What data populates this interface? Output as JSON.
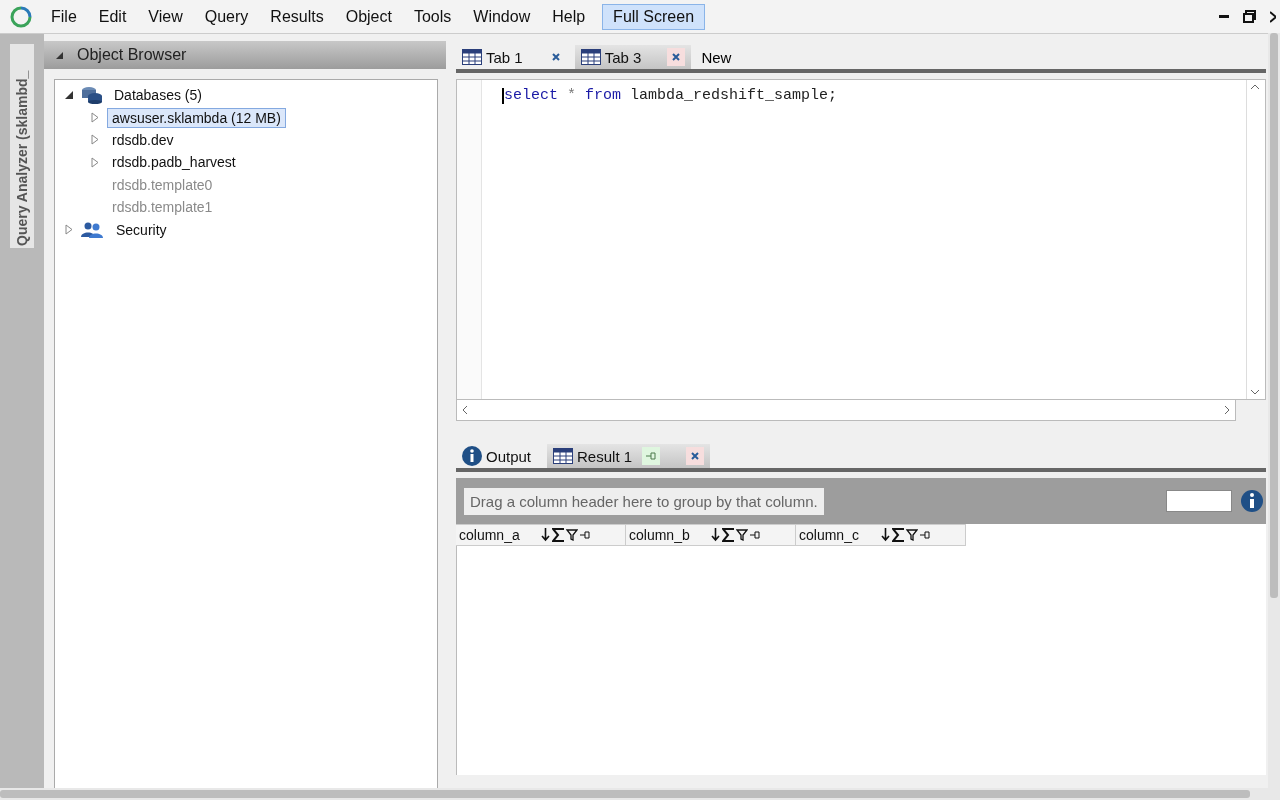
{
  "menu": [
    "File",
    "Edit",
    "View",
    "Query",
    "Results",
    "Object",
    "Tools",
    "Window",
    "Help"
  ],
  "full_screen_button": {
    "label": "Full Screen",
    "on": true
  },
  "side_strip": {
    "title": "Query Analyzer (sklambd_"
  },
  "object_browser": {
    "title": "Object Browser",
    "tree": [
      {
        "label": "Databases (5)",
        "kind": "database",
        "expanded": true,
        "selected": false,
        "disabled": false,
        "children": [
          {
            "label": "awsuser.sklambda (12 MB)",
            "expanded": false,
            "selected": true,
            "disabled": false
          },
          {
            "label": "rdsdb.dev",
            "expanded": false,
            "selected": false,
            "disabled": false
          },
          {
            "label": "rdsdb.padb_harvest",
            "expanded": false,
            "selected": false,
            "disabled": false
          },
          {
            "label": "rdsdb.template0",
            "selected": false,
            "disabled": true
          },
          {
            "label": "rdsdb.template1",
            "selected": false,
            "disabled": true
          }
        ]
      },
      {
        "label": "Security",
        "kind": "users",
        "expanded": false,
        "selected": false,
        "disabled": false
      }
    ]
  },
  "editor_tabs": [
    {
      "label": "Tab 1",
      "kind": "query",
      "selected": false
    },
    {
      "label": "Tab 3",
      "kind": "query",
      "selected": true
    },
    {
      "label": "New",
      "kind": "new",
      "selected": false
    }
  ],
  "editor": {
    "tokens": [
      {
        "text": "select",
        "kind": "keyword"
      },
      {
        "text": " * ",
        "kind": "operator"
      },
      {
        "text": "from",
        "kind": "keyword"
      },
      {
        "text": " lambda_redshift_sample;",
        "kind": "identifier"
      }
    ]
  },
  "result_tabs": [
    {
      "label": "Output",
      "kind": "info",
      "selected": false
    },
    {
      "label": "Result 1",
      "kind": "grid",
      "selected": true
    }
  ],
  "results": {
    "group_hint": "Drag a column header here to group by that column.",
    "columns": [
      "column_a",
      "column_b",
      "column_c"
    ]
  }
}
